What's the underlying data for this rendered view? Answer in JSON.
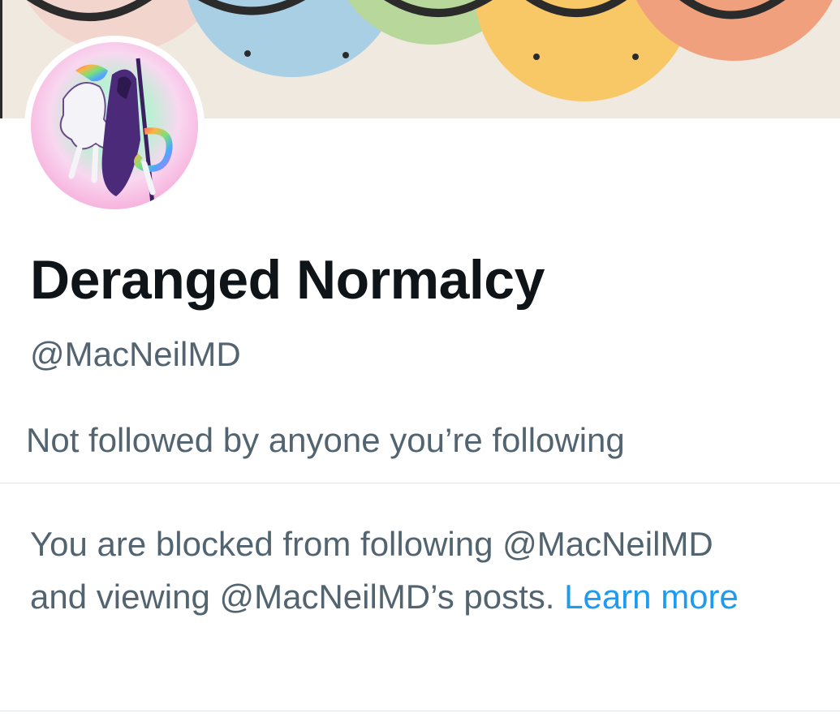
{
  "profile": {
    "display_name": "Deranged Normalcy",
    "handle": "@MacNeilMD",
    "followed_by": "Not followed by anyone you’re following"
  },
  "blocked_notice": {
    "line1": "You are blocked from following @MacNeilMD",
    "line2": "and viewing @MacNeilMD’s posts.",
    "learn_more": "Learn more"
  },
  "colors": {
    "text_primary": "#0f1419",
    "text_secondary": "#536471",
    "link": "#1d9bf0",
    "divider": "#dfe4e8"
  }
}
